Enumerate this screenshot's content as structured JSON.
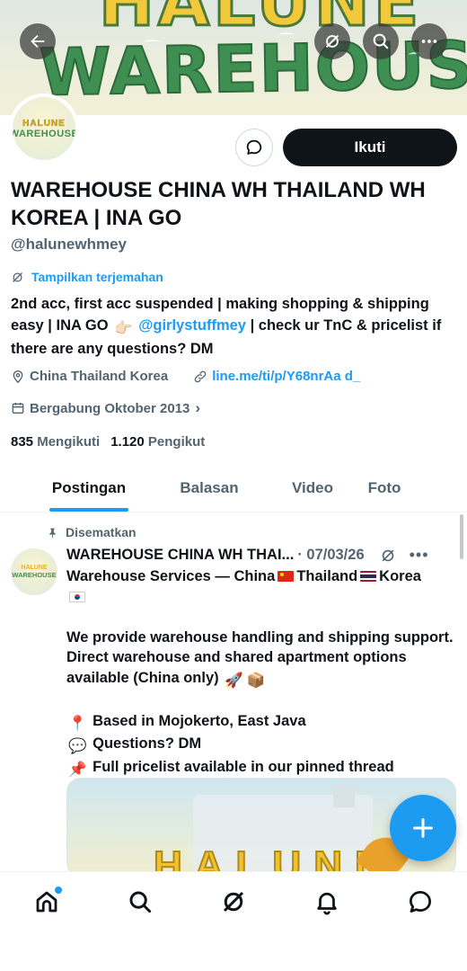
{
  "banner": {
    "brand_top": "HALUNE",
    "brand_main": "WAREHOUSE"
  },
  "avatar": {
    "line1": "HALUNE",
    "line2": "WAREHOUSE"
  },
  "actions": {
    "follow_label": "Ikuti"
  },
  "profile": {
    "display_name": "WAREHOUSE CHINA WH THAILAND WH KOREA | INA GO",
    "handle": "@halunewhmey",
    "translate_label": "Tampilkan terjemahan",
    "bio_part1": "2nd acc, first acc suspended | making shopping & shipping easy | INA GO ",
    "bio_mention": "@girlystuffmey",
    "bio_part2": " | check ur TnC & pricelist if there are any questions? DM",
    "location": "China Thailand Korea",
    "link": "line.me/ti/p/Y68nrAa d_",
    "joined": "Bergabung Oktober 2013",
    "following_count": "835",
    "following_label": "Mengikuti",
    "followers_count": "1.120",
    "followers_label": "Pengikut"
  },
  "tabs": [
    {
      "label": "Postingan",
      "active": true
    },
    {
      "label": "Balasan",
      "active": false
    },
    {
      "label": "Video",
      "active": false
    },
    {
      "label": "Foto",
      "active": false
    }
  ],
  "post": {
    "pinned_label": "Disematkan",
    "author_name": "WAREHOUSE CHINA WH THAI...",
    "date": "· 07/03/26",
    "line1_a": "Warehouse Services — China",
    "line1_b": "Thailand",
    "line1_c": "Korea",
    "para2": "We provide warehouse handling and shipping support. Direct warehouse and shared apartment options available (China only)",
    "based": "Based in Mojokerto, East Java",
    "questions": "Questions? DM",
    "pricelist": "Full pricelist available in our pinned thread",
    "media_text": "HALUNE"
  },
  "icons": {
    "back": "arrow-left-icon",
    "grok": "grok-icon",
    "search": "search-icon",
    "more": "more-icon",
    "message": "message-icon",
    "location": "location-pin-icon",
    "link": "link-icon",
    "calendar": "calendar-icon",
    "pin": "pin-icon",
    "compose": "plus-icon",
    "home": "home-icon",
    "notifications": "bell-icon",
    "chat": "chat-icon"
  },
  "colors": {
    "accent": "#1d9bf0",
    "text": "#0f1419",
    "muted": "#536471",
    "follow_bg": "#0f1419"
  }
}
